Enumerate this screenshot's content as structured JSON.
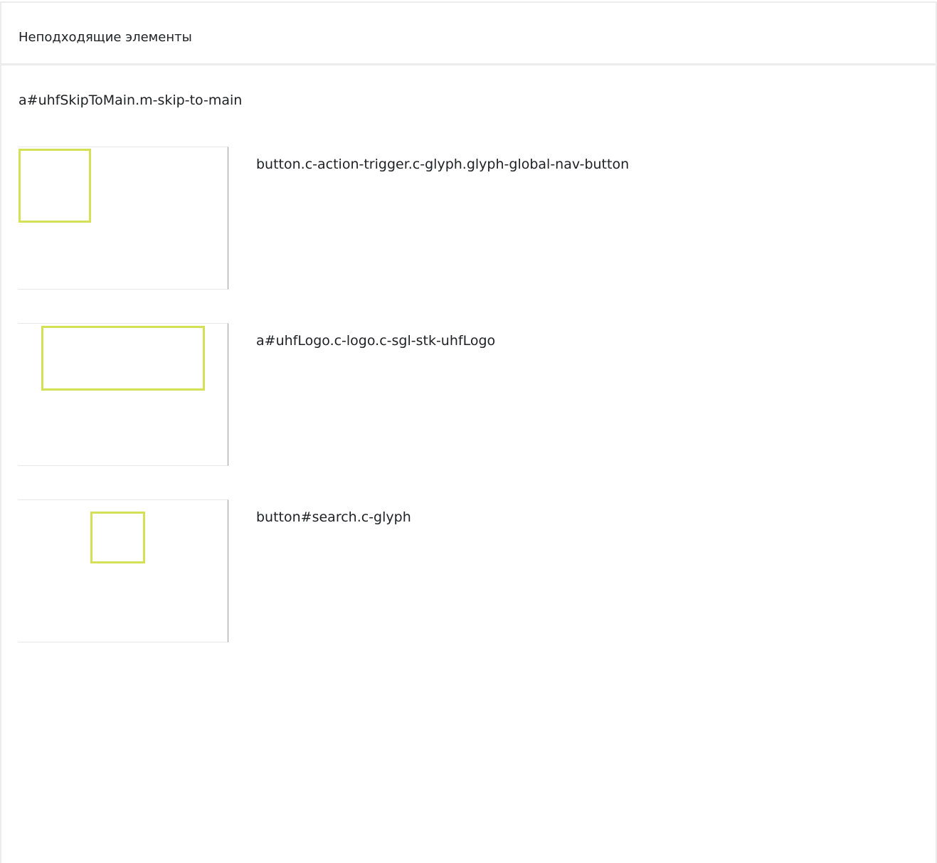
{
  "header": {
    "title": "Неподходящие элементы"
  },
  "skip_link": {
    "selector": "a#uhfSkipToMain.m-skip-to-main"
  },
  "items": [
    {
      "selector": "button.c-action-trigger.c-glyph.glyph-global-nav-button"
    },
    {
      "selector": "a#uhfLogo.c-logo.c-sgl-stk-uhfLogo"
    },
    {
      "selector": "button#search.c-glyph"
    }
  ],
  "colors": {
    "highlight": "#d4e157",
    "border": "#ececec"
  }
}
